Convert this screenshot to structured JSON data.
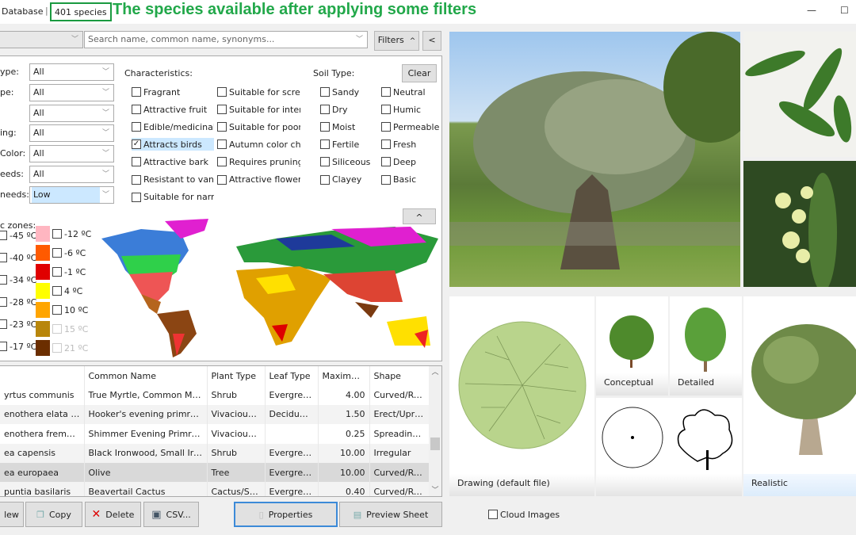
{
  "titlebar": {
    "app": "Database",
    "separator": "|",
    "species_count": "401 species",
    "annotation": "The species available after applying some filters",
    "minimize": "—",
    "maximize": "☐"
  },
  "search": {
    "placeholder": "Search name, common name, synonyms...",
    "filters_label": "Filters",
    "filters_caret": "^",
    "collapse_label": "<"
  },
  "filters": {
    "dropdowns": [
      {
        "label": "ype:",
        "value": "All"
      },
      {
        "label": "pe:",
        "value": "All"
      },
      {
        "label": "",
        "value": "All"
      },
      {
        "label": "ing:",
        "value": "All"
      },
      {
        "label": "Color:",
        "value": "All"
      },
      {
        "label": "eeds:",
        "value": "All"
      },
      {
        "label": "needs:",
        "value": "Low",
        "highlighted": true
      }
    ],
    "characteristics_label": "Characteristics:",
    "characteristics_col1": [
      {
        "label": "Fragrant",
        "checked": false
      },
      {
        "label": "Attractive fruit",
        "checked": false
      },
      {
        "label": "Edible/medicinal f",
        "checked": false
      },
      {
        "label": "Attracts birds",
        "checked": true
      },
      {
        "label": "Attractive bark",
        "checked": false
      },
      {
        "label": "Resistant to vanda",
        "checked": false
      },
      {
        "label": "Suitable for narrov",
        "checked": false
      }
    ],
    "characteristics_col2": [
      {
        "label": "Suitable for screen",
        "checked": false
      },
      {
        "label": "Suitable for interic",
        "checked": false
      },
      {
        "label": "Suitable for poor s",
        "checked": false
      },
      {
        "label": "Autumn color char",
        "checked": false
      },
      {
        "label": "Requires pruning",
        "checked": false
      },
      {
        "label": "Attractive flower",
        "checked": false
      }
    ],
    "soil_label": "Soil Type:",
    "soil_col1": [
      {
        "label": "Sandy",
        "checked": false
      },
      {
        "label": "Dry",
        "checked": false
      },
      {
        "label": "Moist",
        "checked": false
      },
      {
        "label": "Fertile",
        "checked": false
      },
      {
        "label": "Siliceous",
        "checked": false
      },
      {
        "label": "Clayey",
        "checked": false
      }
    ],
    "soil_col2": [
      {
        "label": "Neutral",
        "checked": false
      },
      {
        "label": "Humic",
        "checked": false
      },
      {
        "label": "Permeable",
        "checked": false
      },
      {
        "label": "Fresh",
        "checked": false
      },
      {
        "label": "Deep",
        "checked": false
      },
      {
        "label": "Basic",
        "checked": false
      }
    ],
    "clear_label": "Clear",
    "zones_label": "c zones:",
    "zones_collapse": "^",
    "zones_col1": [
      "-45 ºC",
      "-40 ºC",
      "-34 ºC",
      "-28 ºC",
      "-23 ºC",
      "-17 ºC"
    ],
    "zones_col2": [
      {
        "label": "-12 ºC",
        "color": "#ffb6c1"
      },
      {
        "label": "-6 ºC",
        "color": "#ff5a00"
      },
      {
        "label": "-1 ºC",
        "color": "#e00000"
      },
      {
        "label": "4 ºC",
        "color": "#ffff00"
      },
      {
        "label": "10 ºC",
        "color": "#ffa500"
      },
      {
        "label": "15 ºC",
        "color": "#b8860b",
        "disabled": true
      },
      {
        "label": "21 ºC",
        "color": "#6b2e00",
        "disabled": true
      }
    ]
  },
  "table": {
    "columns": [
      "",
      "Common Name",
      "Plant Type",
      "Leaf Type",
      "Maximum...",
      "Shape"
    ],
    "rows": [
      [
        "yrtus communis",
        "True Myrtle, Common Myrtl...",
        "Shrub",
        "Evergreen",
        "4.00",
        "Curved/Rou..."
      ],
      [
        "enothera elata ssp. h...",
        "Hooker's evening primrose",
        "Vivacious/...",
        "Deciduous",
        "1.50",
        "Erect/Uprig..."
      ],
      [
        "enothera fremontii '...",
        "Shimmer Evening Primrose",
        "Vivacious/...",
        "",
        "0.25",
        "Spreading/..."
      ],
      [
        "ea capensis",
        "Black Ironwood, Small Iron...",
        "Shrub",
        "Evergreen",
        "10.00",
        "Irregular"
      ],
      [
        "ea europaea",
        "Olive",
        "Tree",
        "Evergreen",
        "10.00",
        "Curved/Rou..."
      ],
      [
        "puntia basilaris",
        "Beavertail Cactus",
        "Cactus/Suc...",
        "Evergreen",
        "0.40",
        "Curved/Rou..."
      ]
    ],
    "selected_row": 4
  },
  "buttons": {
    "new": "lew",
    "copy": "Copy",
    "delete": "Delete",
    "csv": "CSV...",
    "properties": "Properties",
    "preview": "Preview Sheet"
  },
  "images": {
    "drawing": "Drawing   (default file)",
    "conceptual": "Conceptual",
    "detailed": "Detailed",
    "realistic": "Realistic",
    "cloud": "Cloud Images"
  }
}
